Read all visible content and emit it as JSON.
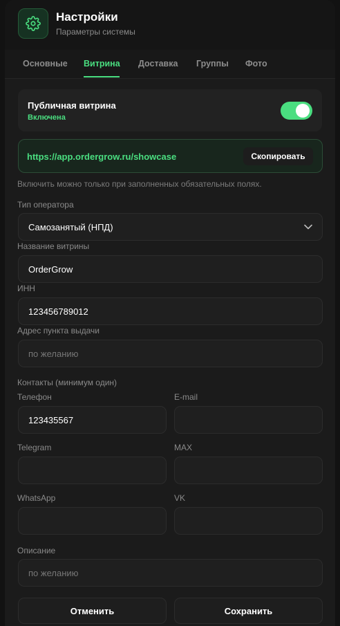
{
  "header": {
    "title": "Настройки",
    "subtitle": "Параметры системы",
    "icon": "gear-icon"
  },
  "tabs": [
    {
      "label": "Основные",
      "active": false
    },
    {
      "label": "Витрина",
      "active": true
    },
    {
      "label": "Доставка",
      "active": false
    },
    {
      "label": "Группы",
      "active": false
    },
    {
      "label": "Фото",
      "active": false
    }
  ],
  "showcase": {
    "title": "Публичная витрина",
    "status": "Включена",
    "enabled": true,
    "url": "https://app.ordergrow.ru/showcase",
    "copy_label": "Скопировать",
    "hint": "Включить можно только при заполненных обязательных полях."
  },
  "form": {
    "operator_type": {
      "label": "Тип оператора",
      "value": "Самозанятый (НПД)"
    },
    "name": {
      "label": "Название витрины",
      "value": "OrderGrow"
    },
    "inn": {
      "label": "ИНН",
      "value": "123456789012"
    },
    "address": {
      "label": "Адрес пункта выдачи",
      "placeholder": "по желанию"
    },
    "contacts_label": "Контакты (минимум один)",
    "phone": {
      "label": "Телефон",
      "value": "123435567"
    },
    "email": {
      "label": "E-mail",
      "value": ""
    },
    "telegram": {
      "label": "Telegram",
      "value": ""
    },
    "max": {
      "label": "MAX",
      "value": ""
    },
    "whatsapp": {
      "label": "WhatsApp",
      "value": ""
    },
    "vk": {
      "label": "VK",
      "value": ""
    },
    "description": {
      "label": "Описание",
      "placeholder": "по желанию"
    }
  },
  "actions": {
    "cancel_label": "Отменить",
    "save_label": "Сохранить"
  },
  "colors": {
    "accent": "#4ade80",
    "background": "#1b1b1b"
  }
}
